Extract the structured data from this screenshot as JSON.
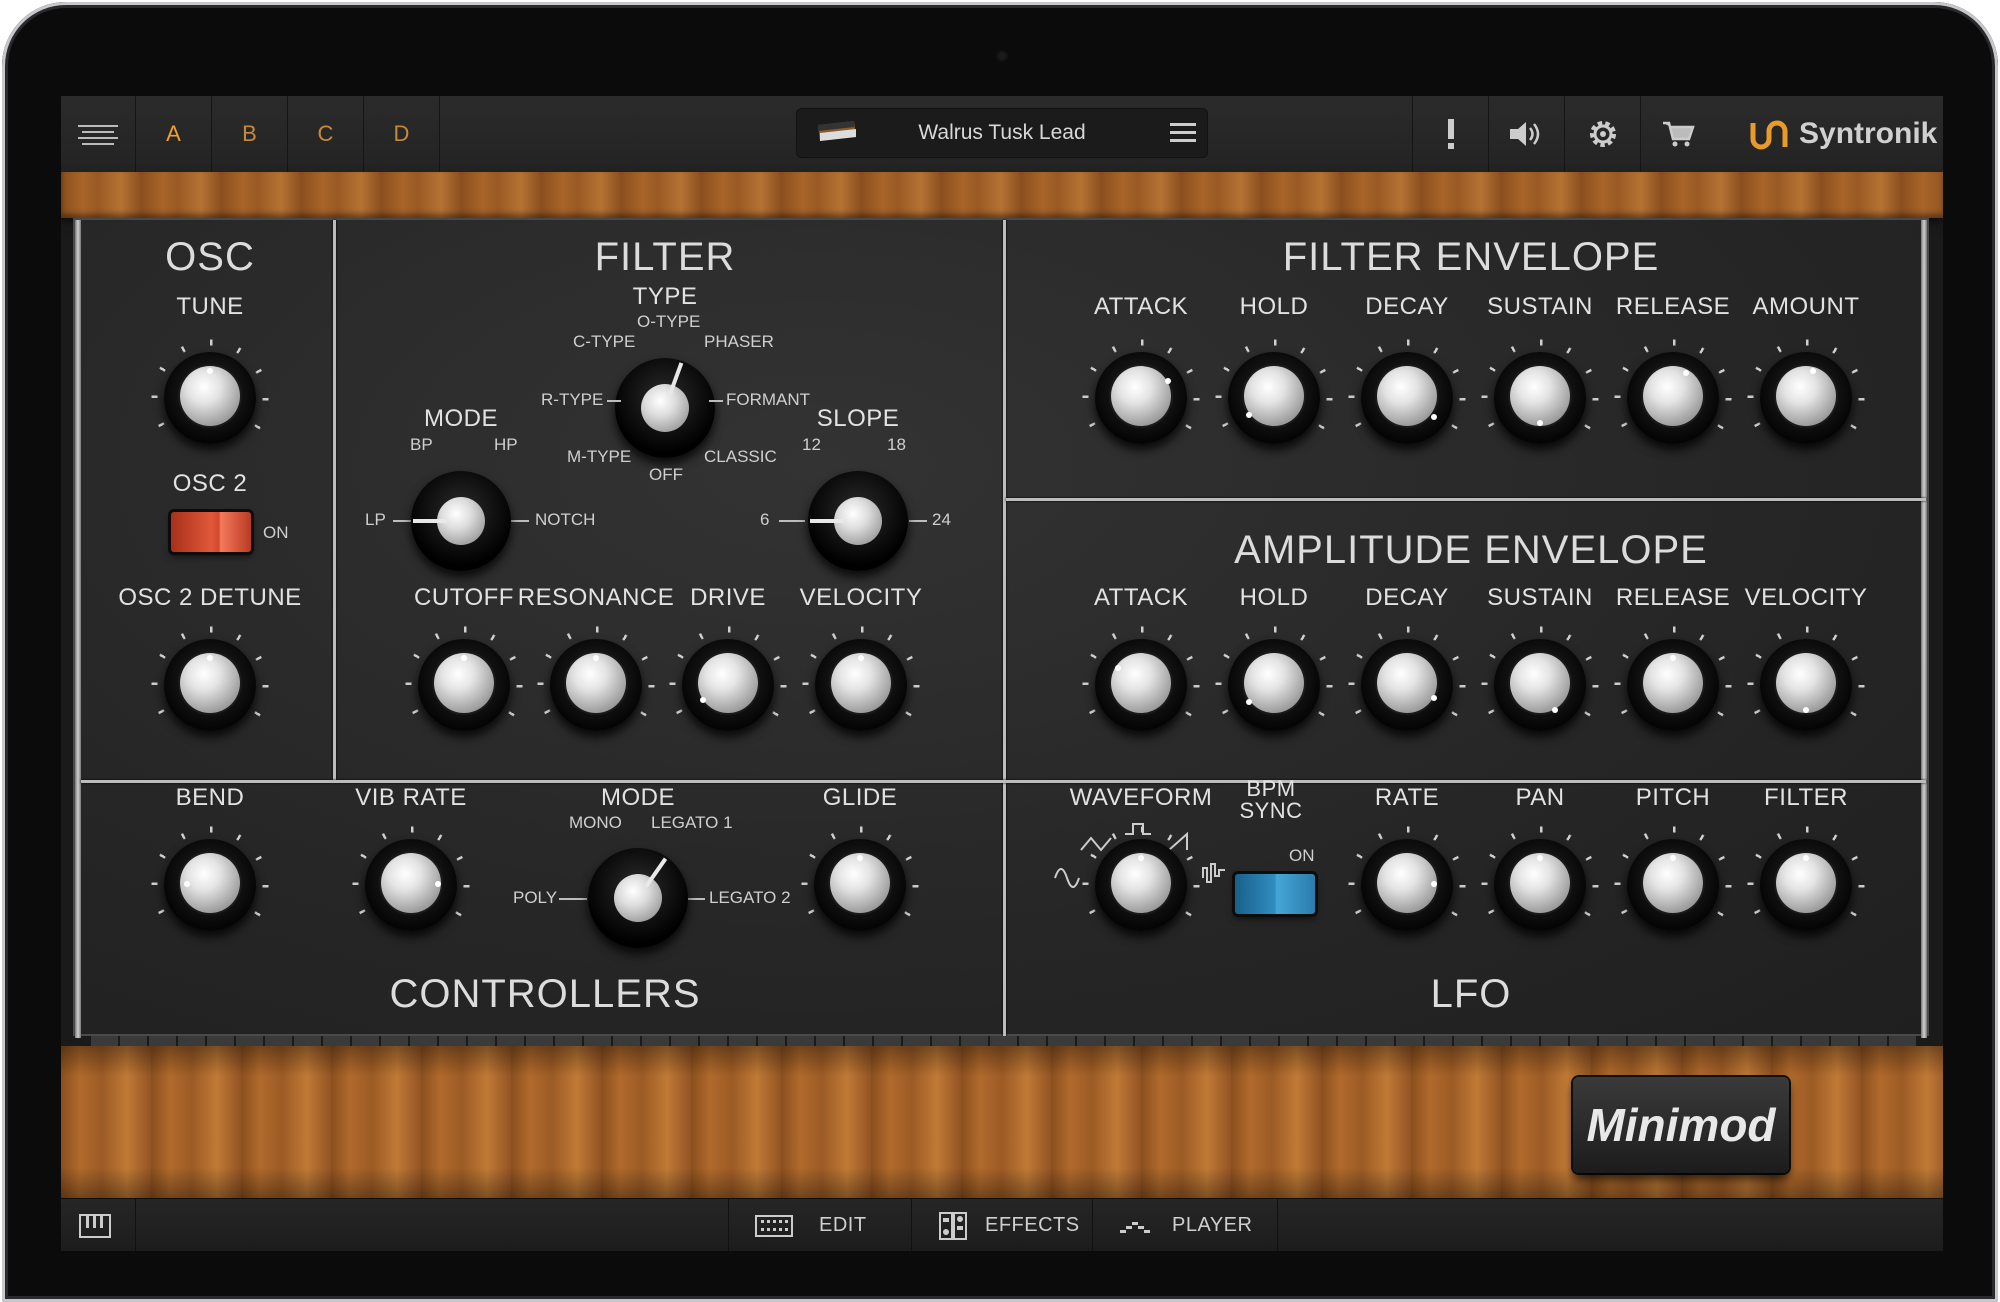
{
  "topbar": {
    "slots": [
      "A",
      "B",
      "C",
      "D"
    ],
    "preset_name": "Walrus Tusk Lead",
    "brand": "Syntronik",
    "icons": [
      "menu-icon",
      "keyboard-thumbnail-icon",
      "hamburger-icon",
      "alert-icon",
      "speaker-icon",
      "gear-icon",
      "cart-icon",
      "syntronik-logo-icon"
    ]
  },
  "osc": {
    "title": "OSC",
    "tune": "TUNE",
    "osc2": "OSC 2",
    "osc2_on": "ON",
    "detune": "OSC 2 DETUNE"
  },
  "filter": {
    "title": "FILTER",
    "type": "TYPE",
    "type_options": [
      "O-TYPE",
      "C-TYPE",
      "PHASER",
      "R-TYPE",
      "FORMANT",
      "M-TYPE",
      "CLASSIC",
      "OFF"
    ],
    "mode": "MODE",
    "mode_options": [
      "BP",
      "HP",
      "LP",
      "NOTCH"
    ],
    "slope": "SLOPE",
    "slope_options": [
      "12",
      "18",
      "6",
      "24"
    ],
    "knobs": [
      "CUTOFF",
      "RESONANCE",
      "DRIVE",
      "VELOCITY"
    ]
  },
  "filter_env": {
    "title": "FILTER ENVELOPE",
    "knobs": [
      "ATTACK",
      "HOLD",
      "DECAY",
      "SUSTAIN",
      "RELEASE",
      "AMOUNT"
    ]
  },
  "amp_env": {
    "title": "AMPLITUDE ENVELOPE",
    "knobs": [
      "ATTACK",
      "HOLD",
      "DECAY",
      "SUSTAIN",
      "RELEASE",
      "VELOCITY"
    ]
  },
  "controllers": {
    "title": "CONTROLLERS",
    "bend": "BEND",
    "vib_rate": "VIB RATE",
    "mode": "MODE",
    "mode_options": [
      "MONO",
      "LEGATO 1",
      "POLY",
      "LEGATO 2"
    ],
    "glide": "GLIDE"
  },
  "lfo": {
    "title": "LFO",
    "waveform": "WAVEFORM",
    "bpm": "BPM",
    "sync": "SYNC",
    "sync_on": "ON",
    "knobs": [
      "RATE",
      "PAN",
      "PITCH",
      "FILTER"
    ]
  },
  "badge": "Minimod",
  "bottombar": {
    "edit": "EDIT",
    "effects": "EFFECTS",
    "player": "PLAYER"
  }
}
